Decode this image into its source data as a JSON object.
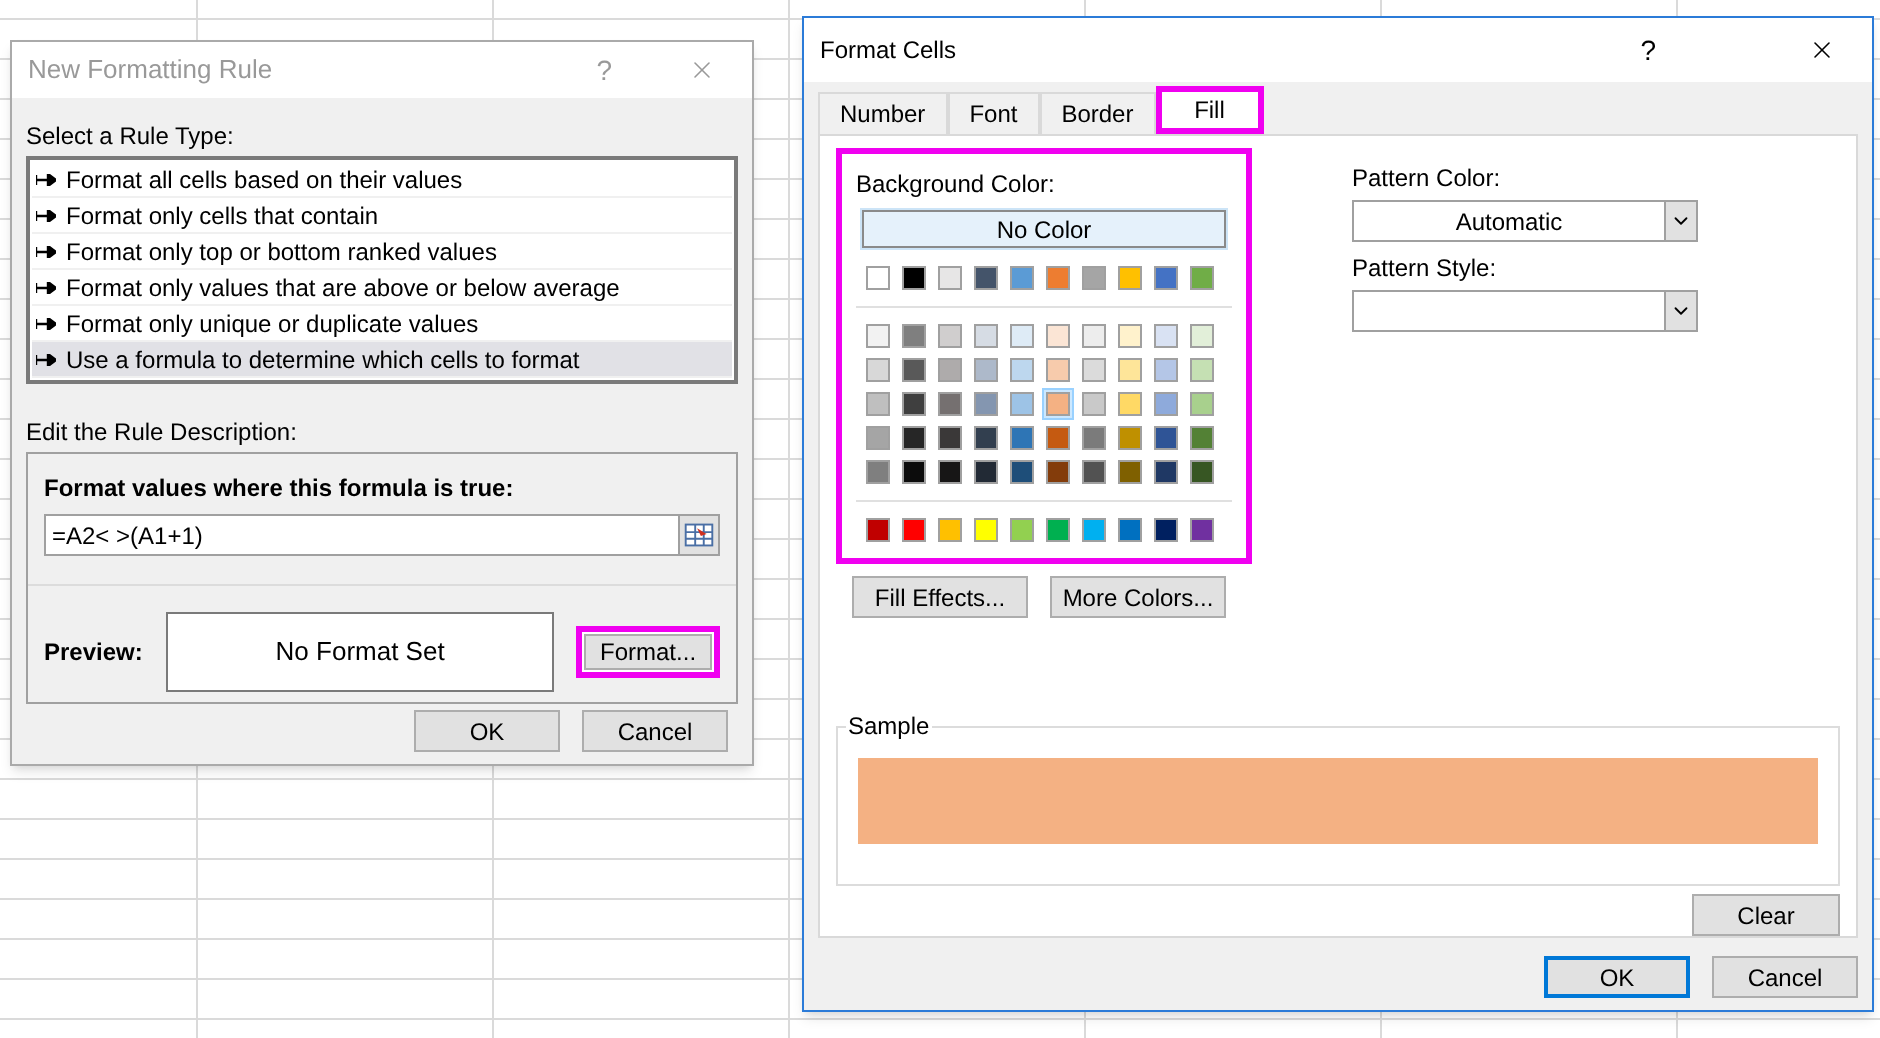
{
  "rule_dialog": {
    "title": "New Formatting Rule",
    "help": "?",
    "rule_type_label": "Select a Rule Type:",
    "rule_types": [
      {
        "label": "Format all cells based on their values",
        "selected": false
      },
      {
        "label": "Format only cells that contain",
        "selected": false
      },
      {
        "label": "Format only top or bottom ranked values",
        "selected": false
      },
      {
        "label": "Format only values that are above or below average",
        "selected": false
      },
      {
        "label": "Format only unique or duplicate values",
        "selected": false
      },
      {
        "label": "Use a formula to determine which cells to format",
        "selected": true
      }
    ],
    "description_label": "Edit the Rule Description:",
    "formula_label": "Format values where this formula is true:",
    "formula": "=A2< >(A1+1)",
    "preview_label": "Preview:",
    "preview_text": "No Format Set",
    "format_button": {
      "label": "Format...",
      "highlighted": true
    },
    "buttons": [
      "OK",
      "Cancel"
    ]
  },
  "format_cells": {
    "title": "Format Cells",
    "help": "?",
    "tabs": [
      {
        "label": "Number",
        "selected": false,
        "highlighted": false
      },
      {
        "label": "Font",
        "selected": false,
        "highlighted": false
      },
      {
        "label": "Border",
        "selected": false,
        "highlighted": false
      },
      {
        "label": "Fill",
        "selected": true,
        "highlighted": true
      }
    ],
    "background_color": {
      "label": "Background Color:",
      "highlighted": true,
      "no_color": "No Color",
      "groups": [
        {
          "rows": [
            {
              "swatches": [
                {
                  "color": "#ffffff",
                  "selected": false
                },
                {
                  "color": "#000000",
                  "selected": false
                },
                {
                  "color": "#e7e6e6",
                  "selected": false
                },
                {
                  "color": "#44546a",
                  "selected": false
                },
                {
                  "color": "#5b9bd5",
                  "selected": false
                },
                {
                  "color": "#ed7d31",
                  "selected": false
                },
                {
                  "color": "#a5a5a5",
                  "selected": false
                },
                {
                  "color": "#ffc000",
                  "selected": false
                },
                {
                  "color": "#4472c4",
                  "selected": false
                },
                {
                  "color": "#70ad47",
                  "selected": false
                }
              ]
            }
          ]
        },
        {
          "rows": [
            {
              "swatches": [
                {
                  "color": "#f2f2f2",
                  "selected": false
                },
                {
                  "color": "#7f7f7f",
                  "selected": false
                },
                {
                  "color": "#d0cece",
                  "selected": false
                },
                {
                  "color": "#d6dce4",
                  "selected": false
                },
                {
                  "color": "#deebf6",
                  "selected": false
                },
                {
                  "color": "#fbe5d5",
                  "selected": false
                },
                {
                  "color": "#ededed",
                  "selected": false
                },
                {
                  "color": "#fff2cc",
                  "selected": false
                },
                {
                  "color": "#d9e2f3",
                  "selected": false
                },
                {
                  "color": "#e2efd9",
                  "selected": false
                }
              ]
            },
            {
              "swatches": [
                {
                  "color": "#d8d8d8",
                  "selected": false
                },
                {
                  "color": "#595959",
                  "selected": false
                },
                {
                  "color": "#aeabab",
                  "selected": false
                },
                {
                  "color": "#adb9ca",
                  "selected": false
                },
                {
                  "color": "#bdd7ee",
                  "selected": false
                },
                {
                  "color": "#f7cbac",
                  "selected": false
                },
                {
                  "color": "#dbdbdb",
                  "selected": false
                },
                {
                  "color": "#fee599",
                  "selected": false
                },
                {
                  "color": "#b4c6e7",
                  "selected": false
                },
                {
                  "color": "#c5e0b3",
                  "selected": false
                }
              ]
            },
            {
              "swatches": [
                {
                  "color": "#bfbfbf",
                  "selected": false
                },
                {
                  "color": "#3f3f3f",
                  "selected": false
                },
                {
                  "color": "#757070",
                  "selected": false
                },
                {
                  "color": "#8496b0",
                  "selected": false
                },
                {
                  "color": "#9dc3e6",
                  "selected": false
                },
                {
                  "color": "#f4b183",
                  "selected": true
                },
                {
                  "color": "#c9c9c9",
                  "selected": false
                },
                {
                  "color": "#ffd965",
                  "selected": false
                },
                {
                  "color": "#8eaadb",
                  "selected": false
                },
                {
                  "color": "#a8d08d",
                  "selected": false
                }
              ]
            },
            {
              "swatches": [
                {
                  "color": "#a5a5a5",
                  "selected": false
                },
                {
                  "color": "#262626",
                  "selected": false
                },
                {
                  "color": "#3a3838",
                  "selected": false
                },
                {
                  "color": "#323f4f",
                  "selected": false
                },
                {
                  "color": "#2e75b5",
                  "selected": false
                },
                {
                  "color": "#c55a11",
                  "selected": false
                },
                {
                  "color": "#7b7b7b",
                  "selected": false
                },
                {
                  "color": "#bf9000",
                  "selected": false
                },
                {
                  "color": "#2f5496",
                  "selected": false
                },
                {
                  "color": "#538135",
                  "selected": false
                }
              ]
            },
            {
              "swatches": [
                {
                  "color": "#7f7f7f",
                  "selected": false
                },
                {
                  "color": "#0c0c0c",
                  "selected": false
                },
                {
                  "color": "#171616",
                  "selected": false
                },
                {
                  "color": "#222a35",
                  "selected": false
                },
                {
                  "color": "#1e4e79",
                  "selected": false
                },
                {
                  "color": "#833c0b",
                  "selected": false
                },
                {
                  "color": "#525252",
                  "selected": false
                },
                {
                  "color": "#7f6000",
                  "selected": false
                },
                {
                  "color": "#1f3864",
                  "selected": false
                },
                {
                  "color": "#375623",
                  "selected": false
                }
              ]
            }
          ]
        },
        {
          "rows": [
            {
              "swatches": [
                {
                  "color": "#c00000",
                  "selected": false
                },
                {
                  "color": "#ff0000",
                  "selected": false
                },
                {
                  "color": "#ffc000",
                  "selected": false
                },
                {
                  "color": "#ffff00",
                  "selected": false
                },
                {
                  "color": "#92d050",
                  "selected": false
                },
                {
                  "color": "#00b050",
                  "selected": false
                },
                {
                  "color": "#00b0f0",
                  "selected": false
                },
                {
                  "color": "#0070c0",
                  "selected": false
                },
                {
                  "color": "#002060",
                  "selected": false
                },
                {
                  "color": "#7030a0",
                  "selected": false
                }
              ]
            }
          ]
        }
      ]
    },
    "effect_buttons": [
      "Fill Effects...",
      "More Colors..."
    ],
    "pattern_color_label": "Pattern Color:",
    "pattern_color": "Automatic",
    "pattern_style_label": "Pattern Style:",
    "sample_label": "Sample",
    "clear_button": "Clear",
    "buttons": [
      "OK",
      "Cancel"
    ]
  }
}
